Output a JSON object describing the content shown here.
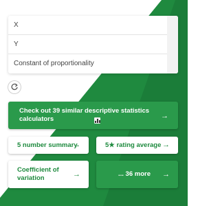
{
  "inputs": [
    {
      "label": "X"
    },
    {
      "label": "Y"
    },
    {
      "label": "Constant of proportionality"
    }
  ],
  "icons": {
    "refresh": "refresh-icon",
    "chart": "bar-chart-icon",
    "arrow": "arrow-right-icon"
  },
  "buttons": {
    "similar": {
      "label": "Check out 39 similar descriptive statistics calculators",
      "arrow": "→"
    },
    "five_number": {
      "label": "5 number summary",
      "arrow": "→"
    },
    "rating": {
      "label": "5★ rating average",
      "arrow": "→"
    },
    "coefficient": {
      "label": "Coefficient of variation",
      "arrow": "→"
    },
    "more": {
      "label": "... 36 more",
      "arrow": "→"
    }
  },
  "colors": {
    "green": "#2a9a4b",
    "green_dark": "#1f8a3f",
    "text_green": "#1e8a3e"
  }
}
